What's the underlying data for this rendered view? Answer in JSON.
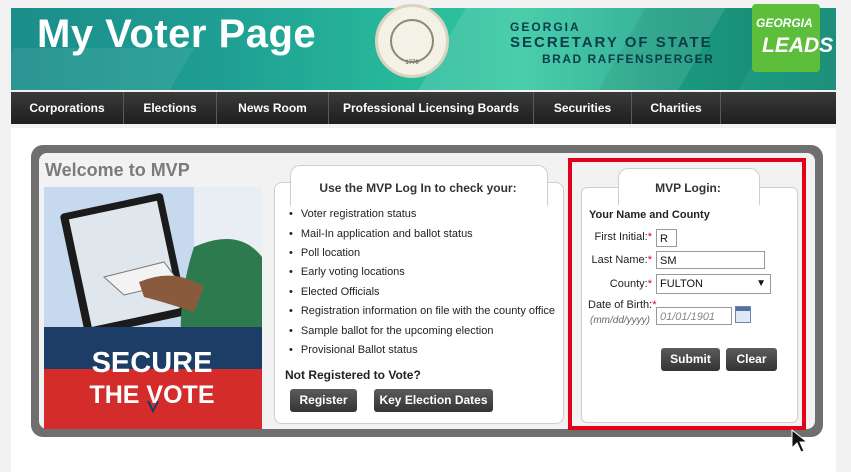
{
  "header": {
    "title": "My Voter Page",
    "state_line1": "GEORGIA",
    "state_line2": "SECRETARY OF STATE",
    "state_line3": "BRAD RAFFENSPERGER",
    "badge_line1": "GEORGIA",
    "badge_line2": "LEADS",
    "seal_year": "1776"
  },
  "nav": {
    "items": [
      "Corporations",
      "Elections",
      "News Room",
      "Professional Licensing Boards",
      "Securities",
      "Charities"
    ]
  },
  "main": {
    "welcome": "Welcome to MVP",
    "photo_text_line1": "SECURE",
    "photo_text_line2": "THE VOTE",
    "info": {
      "heading": "Use the MVP Log In to check your:",
      "items": [
        "Voter registration status",
        "Mail-In application and ballot status",
        "Poll location",
        "Early voting locations",
        "Elected Officials",
        "Registration information on file with the county office",
        "Sample ballot for the upcoming election",
        "Provisional Ballot status"
      ],
      "not_registered": "Not Registered to Vote?",
      "register_label": "Register",
      "key_dates_label": "Key Election Dates"
    },
    "login": {
      "heading": "MVP Login:",
      "subheading": "Your Name and County",
      "first_initial_label": "First Initial:",
      "first_initial_value": "R",
      "last_name_label": "Last Name:",
      "last_name_value": "SM",
      "county_label": "County:",
      "county_value": "FULTON",
      "dob_label": "Date of Birth:",
      "dob_hint": "(mm/dd/yyyy)",
      "dob_placeholder": "01/01/1901",
      "required_mark": "*",
      "submit_label": "Submit",
      "clear_label": "Clear"
    }
  },
  "colors": {
    "highlight": "#e2001a",
    "nav_bg": "#2a2a2a",
    "banner_teal": "#26b69a"
  }
}
